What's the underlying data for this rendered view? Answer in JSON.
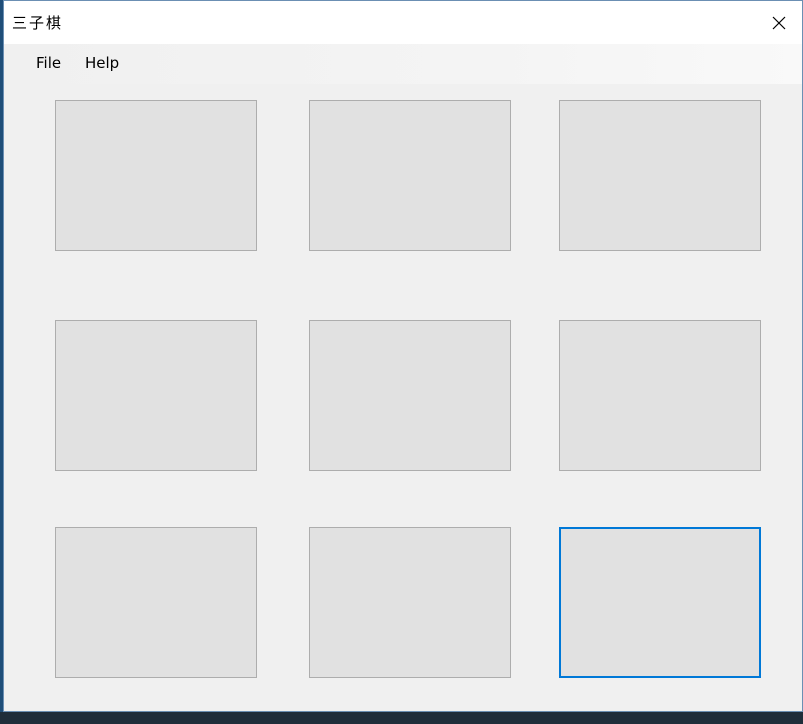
{
  "window": {
    "title": "三子棋"
  },
  "menu": {
    "file_label": "File",
    "help_label": "Help"
  },
  "board": {
    "cells": [
      "",
      "",
      "",
      "",
      "",
      "",
      "",
      "",
      ""
    ],
    "focused_cell": 8
  },
  "colors": {
    "focus_border": "#0078d7",
    "cell_background": "#e1e1e1",
    "window_background": "#f0f0f0"
  }
}
